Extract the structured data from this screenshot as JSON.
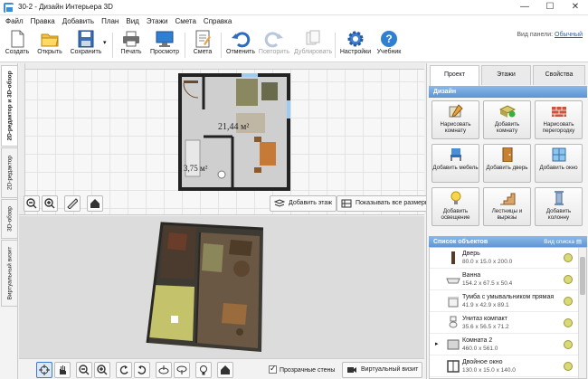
{
  "window": {
    "title": "30-2 - Дизайн Интерьера 3D",
    "minimize": "—",
    "maximize": "☐",
    "close": "✕"
  },
  "menu": [
    "Файл",
    "Правка",
    "Добавить",
    "План",
    "Вид",
    "Этажи",
    "Смета",
    "Справка"
  ],
  "toolbar": {
    "create": "Создать",
    "open": "Открыть",
    "save": "Сохранить",
    "print": "Печать",
    "preview": "Просмотр",
    "estimate": "Смета",
    "undo": "Отменить",
    "redo": "Повторить",
    "duplicate": "Дублировать",
    "settings": "Настройки",
    "tutorial": "Учебник",
    "panel_view_label": "Вид панели:",
    "panel_view_value": "Обычный"
  },
  "left_tabs": [
    "2D-редактор и 3D-обзор",
    "2D-редактор",
    "3D-обзор",
    "Виртуальный визит"
  ],
  "plan": {
    "room1_area": "21,44 м²",
    "room2_area": "3,75 м²"
  },
  "plan_tools": {
    "add_floor": "Добавить этаж",
    "show_all_sizes": "Показывать все размеры"
  },
  "bottom_tools": {
    "transparent_walls": "Прозрачные стены",
    "virtual_visit": "Виртуальный визит"
  },
  "right_panel": {
    "tabs": [
      "Проект",
      "Этажи",
      "Свойства"
    ],
    "design_header": "Дизайн",
    "tools": [
      "Нарисовать комнату",
      "Добавить комнату",
      "Нарисовать перегородку",
      "Добавить мебель",
      "Добавить дверь",
      "Добавить окно",
      "Добавить освещение",
      "Лестницы и вырезы",
      "Добавить колонну"
    ],
    "objects_header": "Список объектов",
    "list_view": "Вид списка",
    "objects": [
      {
        "name": "Дверь",
        "size": "80.0 x 15.0 x 200.0"
      },
      {
        "name": "Ванна",
        "size": "154.2 x 67.5 x 50.4"
      },
      {
        "name": "Тумба с умывальником прямая",
        "size": "41.9 x 42.9 x 89.1"
      },
      {
        "name": "Унитаз компакт",
        "size": "35.6 x 56.5 x 71.2"
      },
      {
        "name": "Комната 2",
        "size": "460.0 x 561.0"
      },
      {
        "name": "Двойное окно",
        "size": "130.0 x 15.0 x 140.0"
      }
    ]
  },
  "colors": {
    "accent_header": "#5d93d4",
    "selected_tab": "#ffffff",
    "floor_gray": "#cfcfcf",
    "wall_dark": "#222222"
  }
}
